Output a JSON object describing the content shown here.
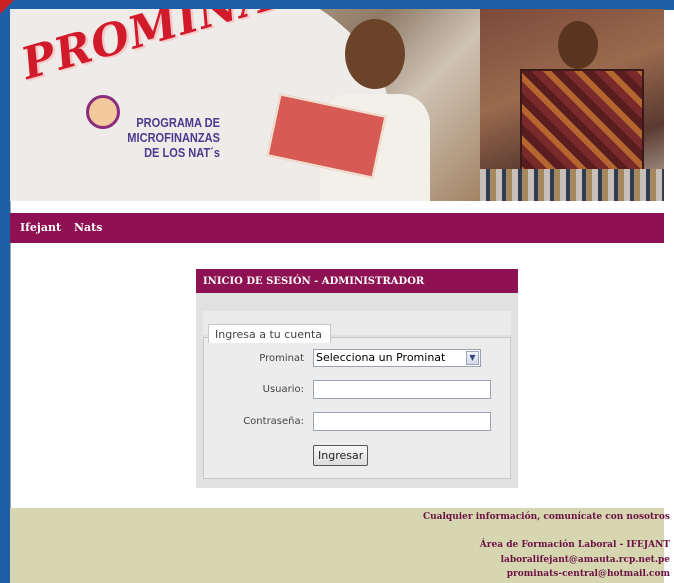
{
  "banner": {
    "logo_text": "PROMINATS",
    "tagline": "PROGRAMA DE MICROFINANZAS DE LOS NAT´s"
  },
  "nav": {
    "items": [
      {
        "label": "Ifejant"
      },
      {
        "label": "Nats"
      }
    ]
  },
  "login": {
    "header": "INICIO DE SESIÓN - ADMINISTRADOR",
    "legend": "Ingresa a tu cuenta",
    "prominat_label": "Prominat",
    "prominat_selected": "Selecciona un Prominat",
    "usuario_label": "Usuario:",
    "usuario_value": "",
    "password_label": "Contraseña:",
    "password_value": "",
    "submit_label": "Ingresar"
  },
  "footer": {
    "contact_line": "Cualquier información, comunícate con nosotros",
    "area": "Área de Formación Laboral - IFEJANT",
    "email1": "laboralifejant@amauta.rcp.net.pe",
    "email2": "prominats-central@hotmail.com"
  },
  "colors": {
    "accent": "#8d1153",
    "frame_bg": "#1d5fa6",
    "footer_bg": "#d6d6b1",
    "panel_bg": "#e1e1e1"
  }
}
